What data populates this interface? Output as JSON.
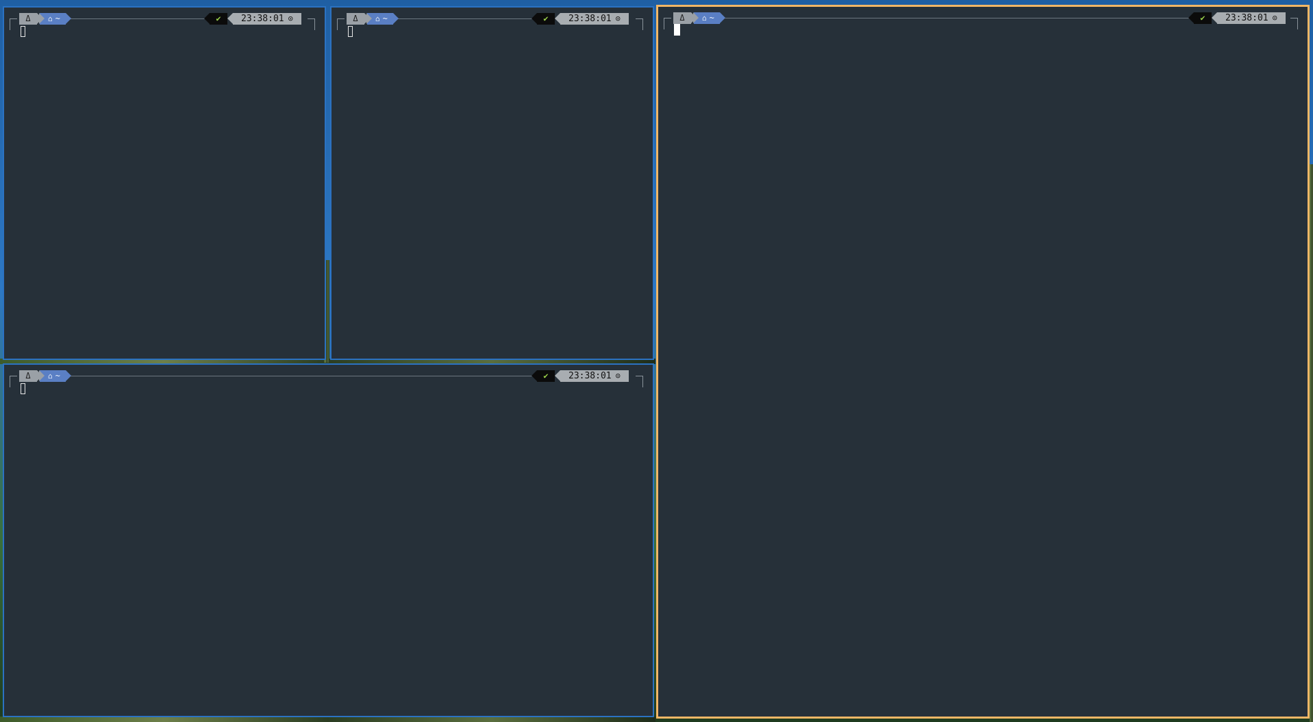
{
  "colors": {
    "terminal_bg": "#263039",
    "focused_border": "#f2b766",
    "unfocused_border": "#2b72c2",
    "os_segment": "#9aa0a6",
    "dir_segment": "#5a7fc4",
    "status_segment": "#0b0b0b",
    "time_segment": "#a8adb1",
    "check_color": "#9bd34a"
  },
  "panes": [
    {
      "id": "top-left",
      "focused": false,
      "prompt": {
        "os_icon": "linux-tux-icon",
        "os_glyph": "Δ",
        "home_glyph": "⌂",
        "dir": "~",
        "status_glyph": "✔",
        "time": "23:38:01",
        "clock_glyph": "⊙"
      }
    },
    {
      "id": "top-middle",
      "focused": false,
      "prompt": {
        "os_icon": "linux-tux-icon",
        "os_glyph": "Δ",
        "home_glyph": "⌂",
        "dir": "~",
        "status_glyph": "✔",
        "time": "23:38:01",
        "clock_glyph": "⊙"
      }
    },
    {
      "id": "right",
      "focused": true,
      "prompt": {
        "os_icon": "linux-tux-icon",
        "os_glyph": "Δ",
        "home_glyph": "⌂",
        "dir": "~",
        "status_glyph": "✔",
        "time": "23:38:01",
        "clock_glyph": "⊙"
      }
    },
    {
      "id": "bottom-left",
      "focused": false,
      "prompt": {
        "os_icon": "linux-tux-icon",
        "os_glyph": "Δ",
        "home_glyph": "⌂",
        "dir": "~",
        "status_glyph": "✔",
        "time": "23:38:01",
        "clock_glyph": "⊙"
      }
    }
  ]
}
